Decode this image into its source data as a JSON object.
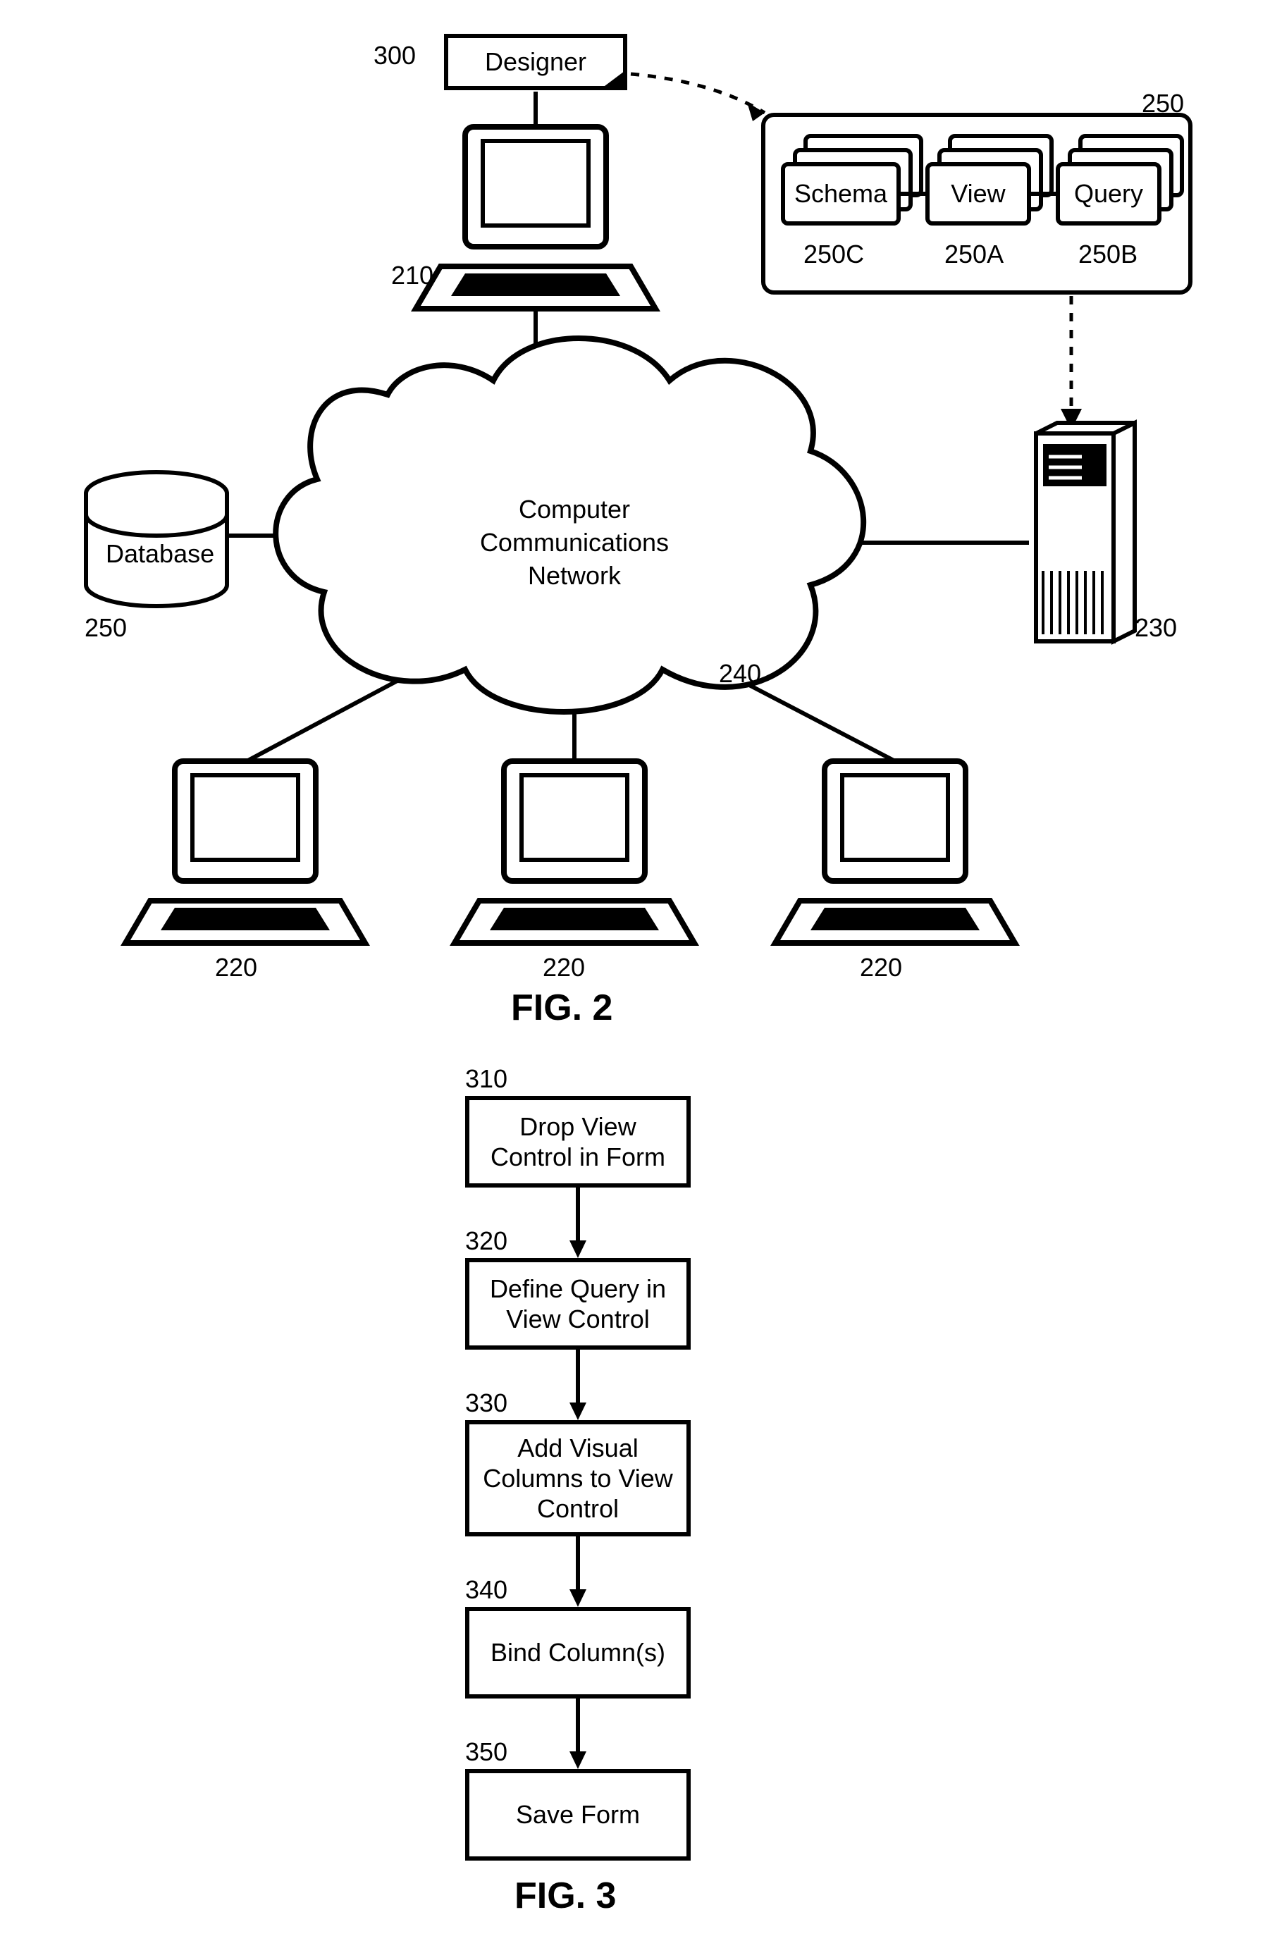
{
  "fig2": {
    "title": "FIG. 2",
    "designer": {
      "ref": "300",
      "label": "Designer"
    },
    "computerTop": {
      "ref": "210"
    },
    "cloud": {
      "ref": "240",
      "label": "Computer\nCommunications\nNetwork"
    },
    "databaseCyl": {
      "ref": "250",
      "label": "Database"
    },
    "server": {
      "ref": "230"
    },
    "panel": {
      "ref": "250",
      "cardSchema": {
        "ref": "250C",
        "label": "Schema"
      },
      "cardView": {
        "ref": "250A",
        "label": "View"
      },
      "cardQuery": {
        "ref": "250B",
        "label": "Query"
      }
    },
    "clientLeft": {
      "ref": "220"
    },
    "clientMiddle": {
      "ref": "220"
    },
    "clientRight": {
      "ref": "220"
    }
  },
  "fig3": {
    "title": "FIG. 3",
    "steps": [
      {
        "ref": "310",
        "label": "Drop View\nControl in Form"
      },
      {
        "ref": "320",
        "label": "Define Query in\nView Control"
      },
      {
        "ref": "330",
        "label": "Add Visual\nColumns to View\nControl"
      },
      {
        "ref": "340",
        "label": "Bind Column(s)"
      },
      {
        "ref": "350",
        "label": "Save Form"
      }
    ]
  }
}
